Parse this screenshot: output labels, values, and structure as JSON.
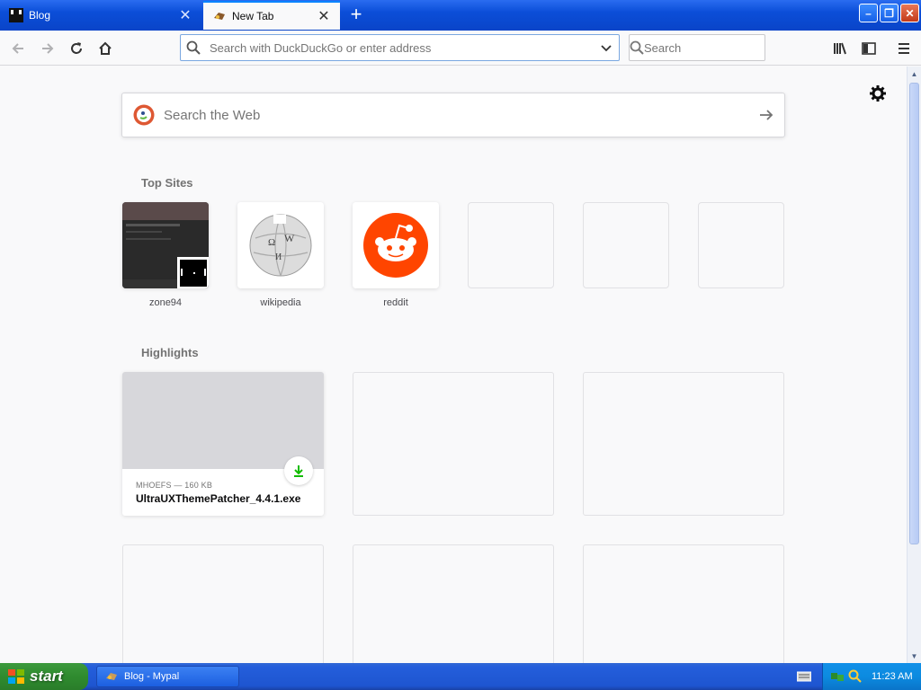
{
  "browser": {
    "tabs": [
      {
        "label": "Blog",
        "active": false
      },
      {
        "label": "New Tab",
        "active": true
      }
    ],
    "url_placeholder": "Search with DuckDuckGo or enter address",
    "search_placeholder": "Search"
  },
  "newtab": {
    "websearch_placeholder": "Search the Web",
    "top_sites_title": "Top Sites",
    "top_sites": [
      {
        "label": "zone94",
        "icon": "zone94-screenshot"
      },
      {
        "label": "wikipedia",
        "icon": "wikipedia-globe-icon"
      },
      {
        "label": "reddit",
        "icon": "reddit-icon"
      },
      {
        "label": "",
        "icon": ""
      },
      {
        "label": "",
        "icon": ""
      },
      {
        "label": "",
        "icon": ""
      }
    ],
    "highlights_title": "Highlights",
    "highlights": [
      {
        "meta": "MHOEFS — 160 KB",
        "name": "UltraUXThemePatcher_4.4.1.exe",
        "icon": "download-icon"
      }
    ]
  },
  "taskbar": {
    "start_label": "start",
    "task_label": "Blog - Mypal",
    "clock": "11:23 AM"
  },
  "colors": {
    "accent": "#0a84ff",
    "download_green": "#12bc00",
    "reddit_orange": "#ff4500"
  }
}
